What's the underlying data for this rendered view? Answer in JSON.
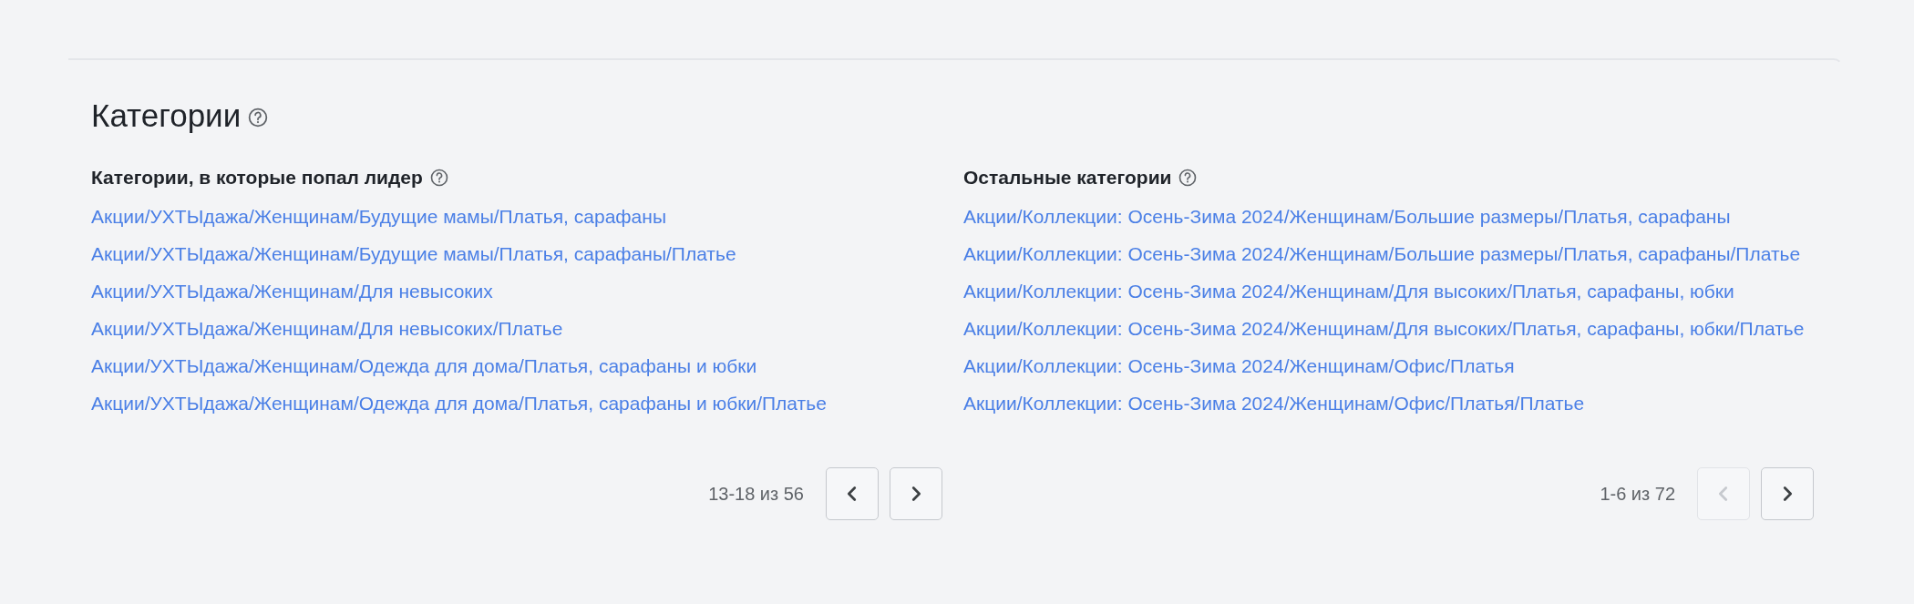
{
  "section": {
    "title": "Категории"
  },
  "columns": [
    {
      "heading": "Категории, в которые попал лидер",
      "links": [
        "Акции/УХТЫдажа/Женщинам/Будущие мамы/Платья, сарафаны",
        "Акции/УХТЫдажа/Женщинам/Будущие мамы/Платья, сарафаны/Платье",
        "Акции/УХТЫдажа/Женщинам/Для невысоких",
        "Акции/УХТЫдажа/Женщинам/Для невысоких/Платье",
        "Акции/УХТЫдажа/Женщинам/Одежда для дома/Платья, сарафаны и юбки",
        "Акции/УХТЫдажа/Женщинам/Одежда для дома/Платья, сарафаны и юбки/Платье"
      ],
      "pager": {
        "range": "13-18 из 56",
        "prev_disabled": false,
        "next_disabled": false
      }
    },
    {
      "heading": "Остальные категории",
      "links": [
        "Акции/Коллекции: Осень-Зима 2024/Женщинам/Большие размеры/Платья, сарафаны",
        "Акции/Коллекции: Осень-Зима 2024/Женщинам/Большие размеры/Платья, сарафаны/Платье",
        "Акции/Коллекции: Осень-Зима 2024/Женщинам/Для высоких/Платья, сарафаны, юбки",
        "Акции/Коллекции: Осень-Зима 2024/Женщинам/Для высоких/Платья, сарафаны, юбки/Платье",
        "Акции/Коллекции: Осень-Зима 2024/Женщинам/Офис/Платья",
        "Акции/Коллекции: Осень-Зима 2024/Женщинам/Офис/Платья/Платье"
      ],
      "pager": {
        "range": "1-6 из 72",
        "prev_disabled": true,
        "next_disabled": false
      }
    }
  ]
}
